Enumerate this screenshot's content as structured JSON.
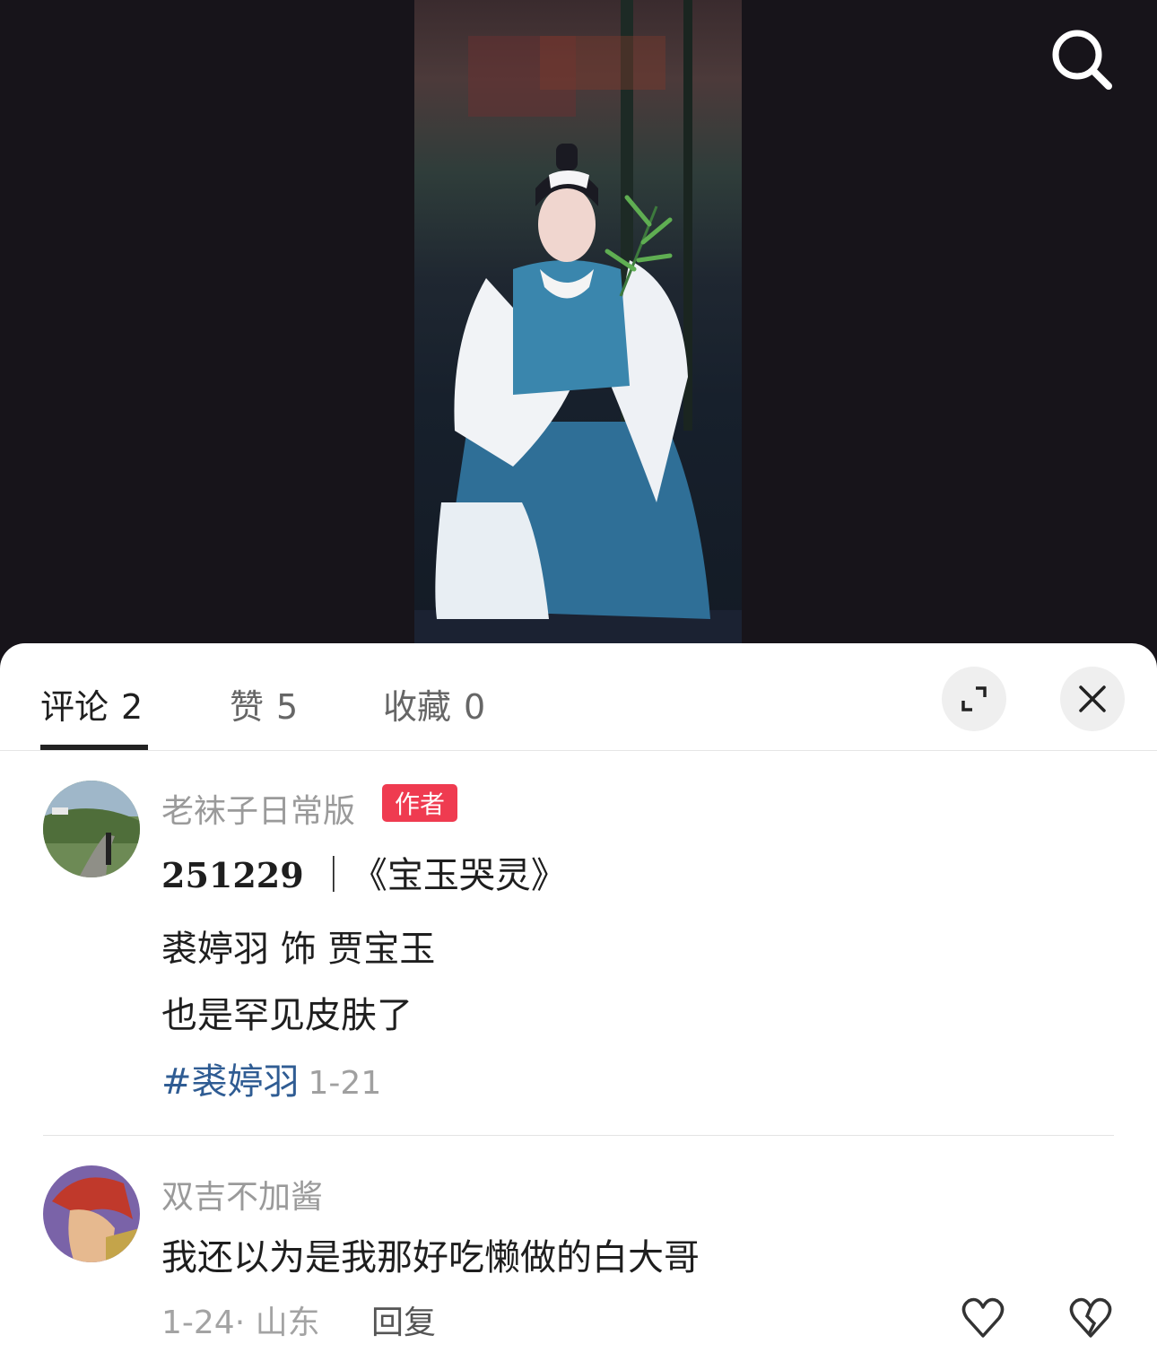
{
  "colors": {
    "sheet_bg": "#ffffff",
    "media_bg": "#17141a",
    "author_badge": "#ef3b50",
    "hashtag": "#2f5c93"
  },
  "header": {
    "search_icon": "search-icon"
  },
  "tabs": [
    {
      "label": "评论",
      "count": "2",
      "active": true
    },
    {
      "label": "赞",
      "count": "5",
      "active": false
    },
    {
      "label": "收藏",
      "count": "0",
      "active": false
    }
  ],
  "controls": {
    "expand_icon": "expand-icon",
    "close_icon": "close-icon"
  },
  "comments": [
    {
      "username": "老袜子日常版",
      "badge": "作者",
      "title_code": "251229",
      "title_rest": "｜《宝玉哭灵》",
      "line2": "裘婷羽 饰 贾宝玉",
      "line3": "也是罕见皮肤了",
      "hashtag": "#裘婷羽",
      "date": "1-21"
    },
    {
      "username": "双吉不加酱",
      "text": "我还以为是我那好吃懒做的白大哥",
      "meta": "1-24· 山东",
      "reply": "回复",
      "like_icon": "heart-icon",
      "dislike_icon": "broken-heart-icon"
    }
  ]
}
